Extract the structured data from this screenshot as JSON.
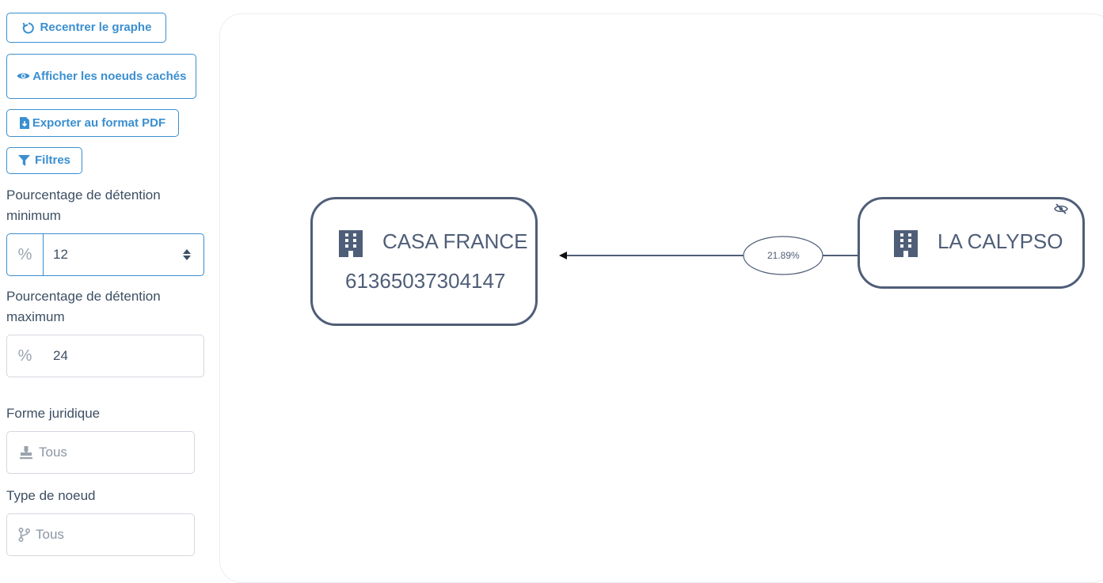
{
  "sidebar": {
    "recenter_label": "Recentrer le graphe",
    "show_hidden_label": "Afficher les noeuds cachés",
    "export_label": "Exporter au format PDF",
    "filters_label": "Filtres",
    "min_label": "Pourcentage de détention minimum",
    "min_value": "12",
    "min_addon": "%",
    "max_label": "Pourcentage de détention maximum",
    "max_value": "24",
    "max_addon": "%",
    "legal_form_label": "Forme juridique",
    "legal_form_placeholder": "Tous",
    "node_type_label": "Type de noeud",
    "node_type_placeholder": "Tous"
  },
  "graph": {
    "nodes": [
      {
        "name": "CASA FRANCE",
        "id": "61365037304147",
        "icon": "building-icon"
      },
      {
        "name": "LA CALYPSO",
        "icon": "building-icon",
        "hidden_toggle_icon": "eye-slash-icon"
      }
    ],
    "edges": [
      {
        "label": "21.89%",
        "from": "LA CALYPSO",
        "to": "CASA FRANCE"
      }
    ]
  },
  "colors": {
    "accent": "#3a8fd0",
    "node": "#4f5e78",
    "text": "#3d4f63"
  }
}
